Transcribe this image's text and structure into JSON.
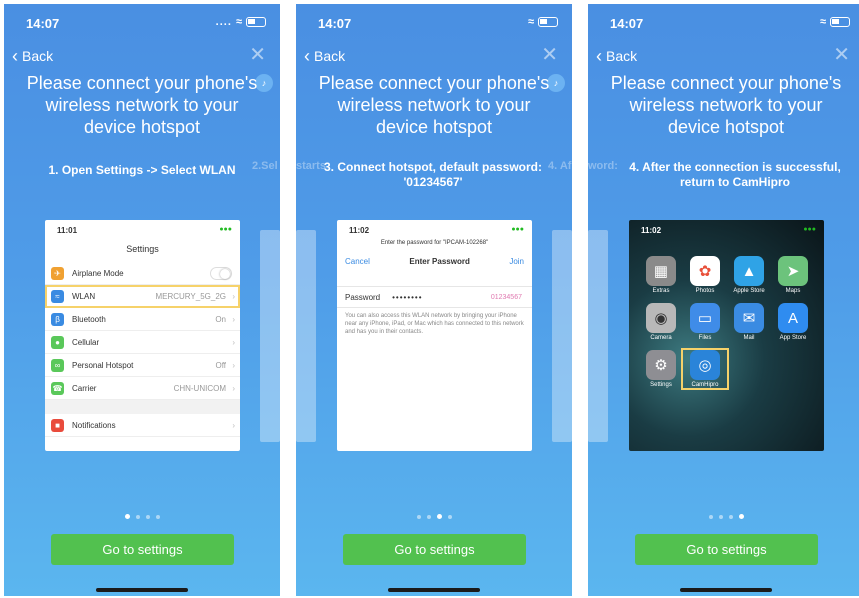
{
  "panels": [
    {
      "time": "14:07",
      "signal": "....",
      "back": "Back",
      "title": "Please connect your phone's wireless network to your device hotspot",
      "step_text": "1. Open Settings -> Select WLAN",
      "side_right": "2.Sel",
      "button": "Go to settings",
      "active_dot": 0
    },
    {
      "time": "14:07",
      "signal": "",
      "back": "Back",
      "title": "Please connect your phone's wireless network to your device hotspot",
      "step_text": "3. Connect hotspot, default password: '01234567'",
      "side_left": "starts",
      "side_right": "4. Af",
      "button": "Go to settings",
      "active_dot": 2
    },
    {
      "time": "14:07",
      "signal": "",
      "back": "Back",
      "title": "Please connect your phone's wireless network to your device hotspot",
      "step_text": "4. After the connection is successful, return to CamHipro",
      "side_left": "word:",
      "button": "Go to settings",
      "active_dot": 3
    }
  ],
  "settings_card": {
    "time": "11:01",
    "title": "Settings",
    "rows": [
      {
        "label": "Airplane Mode",
        "value": "",
        "icon_color": "#f0a132"
      },
      {
        "label": "WLAN",
        "value": "MERCURY_5G_2G",
        "icon_color": "#3a8be2"
      },
      {
        "label": "Bluetooth",
        "value": "On",
        "icon_color": "#3a8be2"
      },
      {
        "label": "Cellular",
        "value": "",
        "icon_color": "#5ac85a"
      },
      {
        "label": "Personal Hotspot",
        "value": "Off",
        "icon_color": "#5ac85a"
      },
      {
        "label": "Carrier",
        "value": "CHN-UNICOM",
        "icon_color": "#5ac85a"
      }
    ],
    "notifications": "Notifications"
  },
  "password_card": {
    "time": "11:02",
    "hint": "Enter the password for \"IPCAM-102268\"",
    "cancel": "Cancel",
    "header": "Enter Password",
    "join": "Join",
    "field_label": "Password",
    "dots": "••••••••",
    "password_hint": "01234567",
    "note": "You can also access this WLAN network by bringing your iPhone near any iPhone, iPad, or Mac which has connected to this network and has you in their contacts."
  },
  "home_card": {
    "time": "11:02",
    "apps": [
      "Extras",
      "Photos",
      "Apple Store",
      "Maps",
      "Camera",
      "Files",
      "Mail",
      "App Store",
      "Settings",
      "CamHipro"
    ]
  },
  "colors": {
    "button": "#52c14f",
    "highlight": "#f6d26a",
    "background_top": "#4a8fe2"
  }
}
